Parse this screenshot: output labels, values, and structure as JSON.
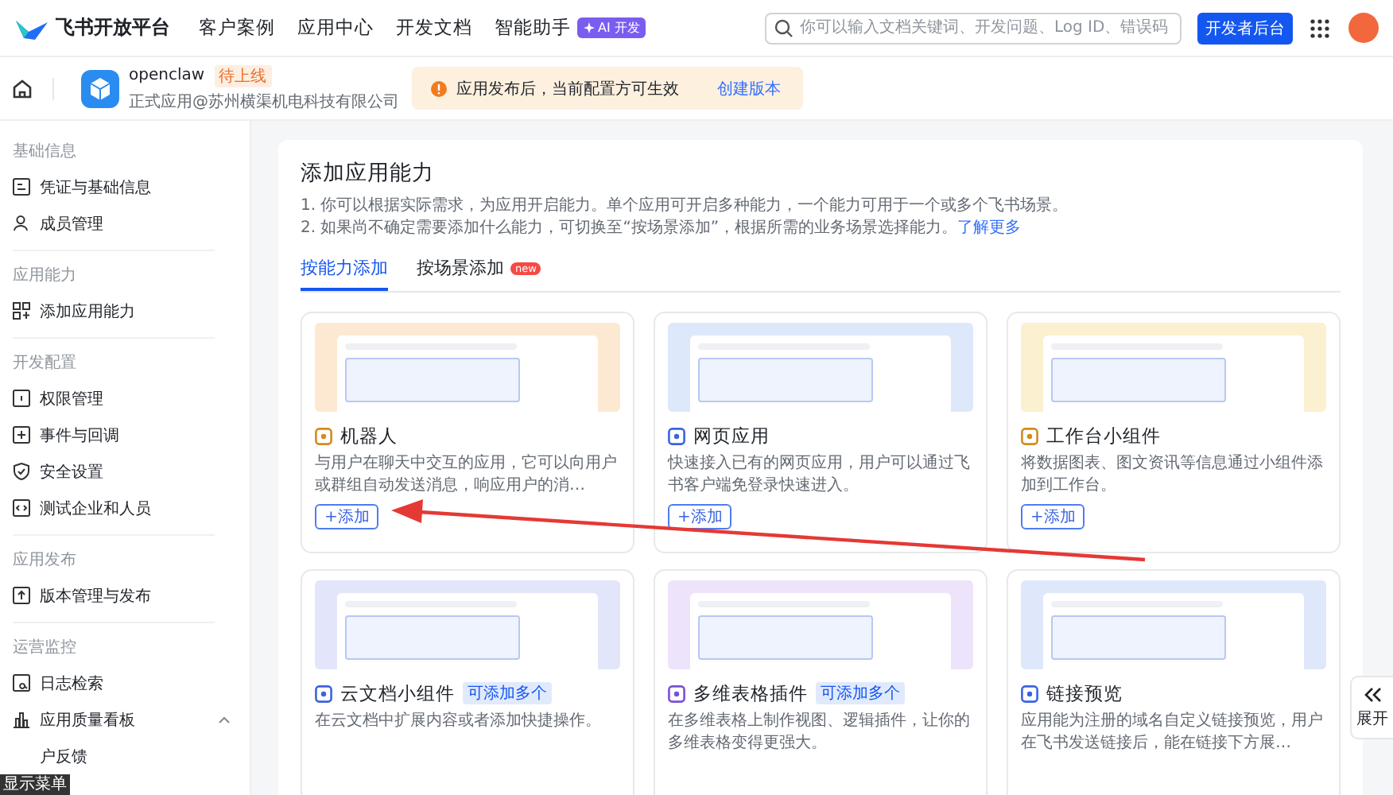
{
  "top_nav": {
    "logo_text": "飞书开放平台",
    "links": [
      "客户案例",
      "应用中心",
      "开发文档",
      "智能助手"
    ],
    "ai_badge": "AI 开发",
    "search": {
      "placeholder": "你可以输入文档关键词、开发问题、Log ID、错误码"
    },
    "console_button": "开发者后台"
  },
  "app_bar": {
    "app_name": "openclaw",
    "status_tag": "待上线",
    "subtitle": "正式应用@苏州横渠机电科技有限公司",
    "notice": {
      "text": "应用发布后，当前配置方可生效",
      "link": "创建版本"
    }
  },
  "sidebar": {
    "sections": [
      {
        "title": "基础信息",
        "items": [
          {
            "label": "凭证与基础信息"
          },
          {
            "label": "成员管理"
          }
        ]
      },
      {
        "title": "应用能力",
        "items": [
          {
            "label": "添加应用能力"
          }
        ]
      },
      {
        "title": "开发配置",
        "items": [
          {
            "label": "权限管理"
          },
          {
            "label": "事件与回调"
          },
          {
            "label": "安全设置"
          },
          {
            "label": "测试企业和人员"
          }
        ]
      },
      {
        "title": "应用发布",
        "items": [
          {
            "label": "版本管理与发布"
          }
        ]
      },
      {
        "title": "运营监控",
        "items": [
          {
            "label": "日志检索"
          },
          {
            "label": "应用质量看板",
            "expanded": true,
            "children": [
              {
                "label": "户反馈"
              }
            ]
          }
        ]
      }
    ],
    "tooltip": "显示菜单"
  },
  "main": {
    "title": "添加应用能力",
    "notes": [
      "1. 你可以根据实际需求，为应用开启能力。单个应用可开启多种能力，一个能力可用于一个或多个飞书场景。",
      "2. 如果尚不确定需要添加什么能力，可切换至“按场景添加”，根据所需的业务场景选择能力。"
    ],
    "learn_more": "了解更多",
    "tabs": [
      {
        "label": "按能力添加",
        "selected": true
      },
      {
        "label": "按场景添加",
        "selected": false,
        "badge": "new"
      }
    ],
    "capabilities": [
      {
        "title": "机器人",
        "description": "与用户在聊天中交互的应用，它可以向用户或群组自动发送消息，响应用户的消…",
        "add_button": "+添加",
        "color": "#fde9d2"
      },
      {
        "title": "网页应用",
        "description": "快速接入已有的网页应用，用户可以通过飞书客户端免登录快速进入。",
        "add_button": "+添加",
        "color": "#dde8fb"
      },
      {
        "title": "工作台小组件",
        "description": "将数据图表、图文资讯等信息通过小组件添加到工作台。",
        "add_button": "+添加",
        "color": "#fbf0cf"
      },
      {
        "title": "云文档小组件",
        "badge": "可添加多个",
        "description": "在云文档中扩展内容或者添加快捷操作。",
        "color": "#e3e6fa"
      },
      {
        "title": "多维表格插件",
        "badge": "可添加多个",
        "description": "在多维表格上制作视图、逻辑插件，让你的多维表格变得更强大。",
        "color": "#ede3fa"
      },
      {
        "title": "链接预览",
        "description": "应用能为注册的域名自定义链接预览，用户在飞书发送链接后，能在链接下方展…",
        "color": "#dfe8fb"
      }
    ]
  },
  "expand_button": {
    "label": "展开"
  }
}
